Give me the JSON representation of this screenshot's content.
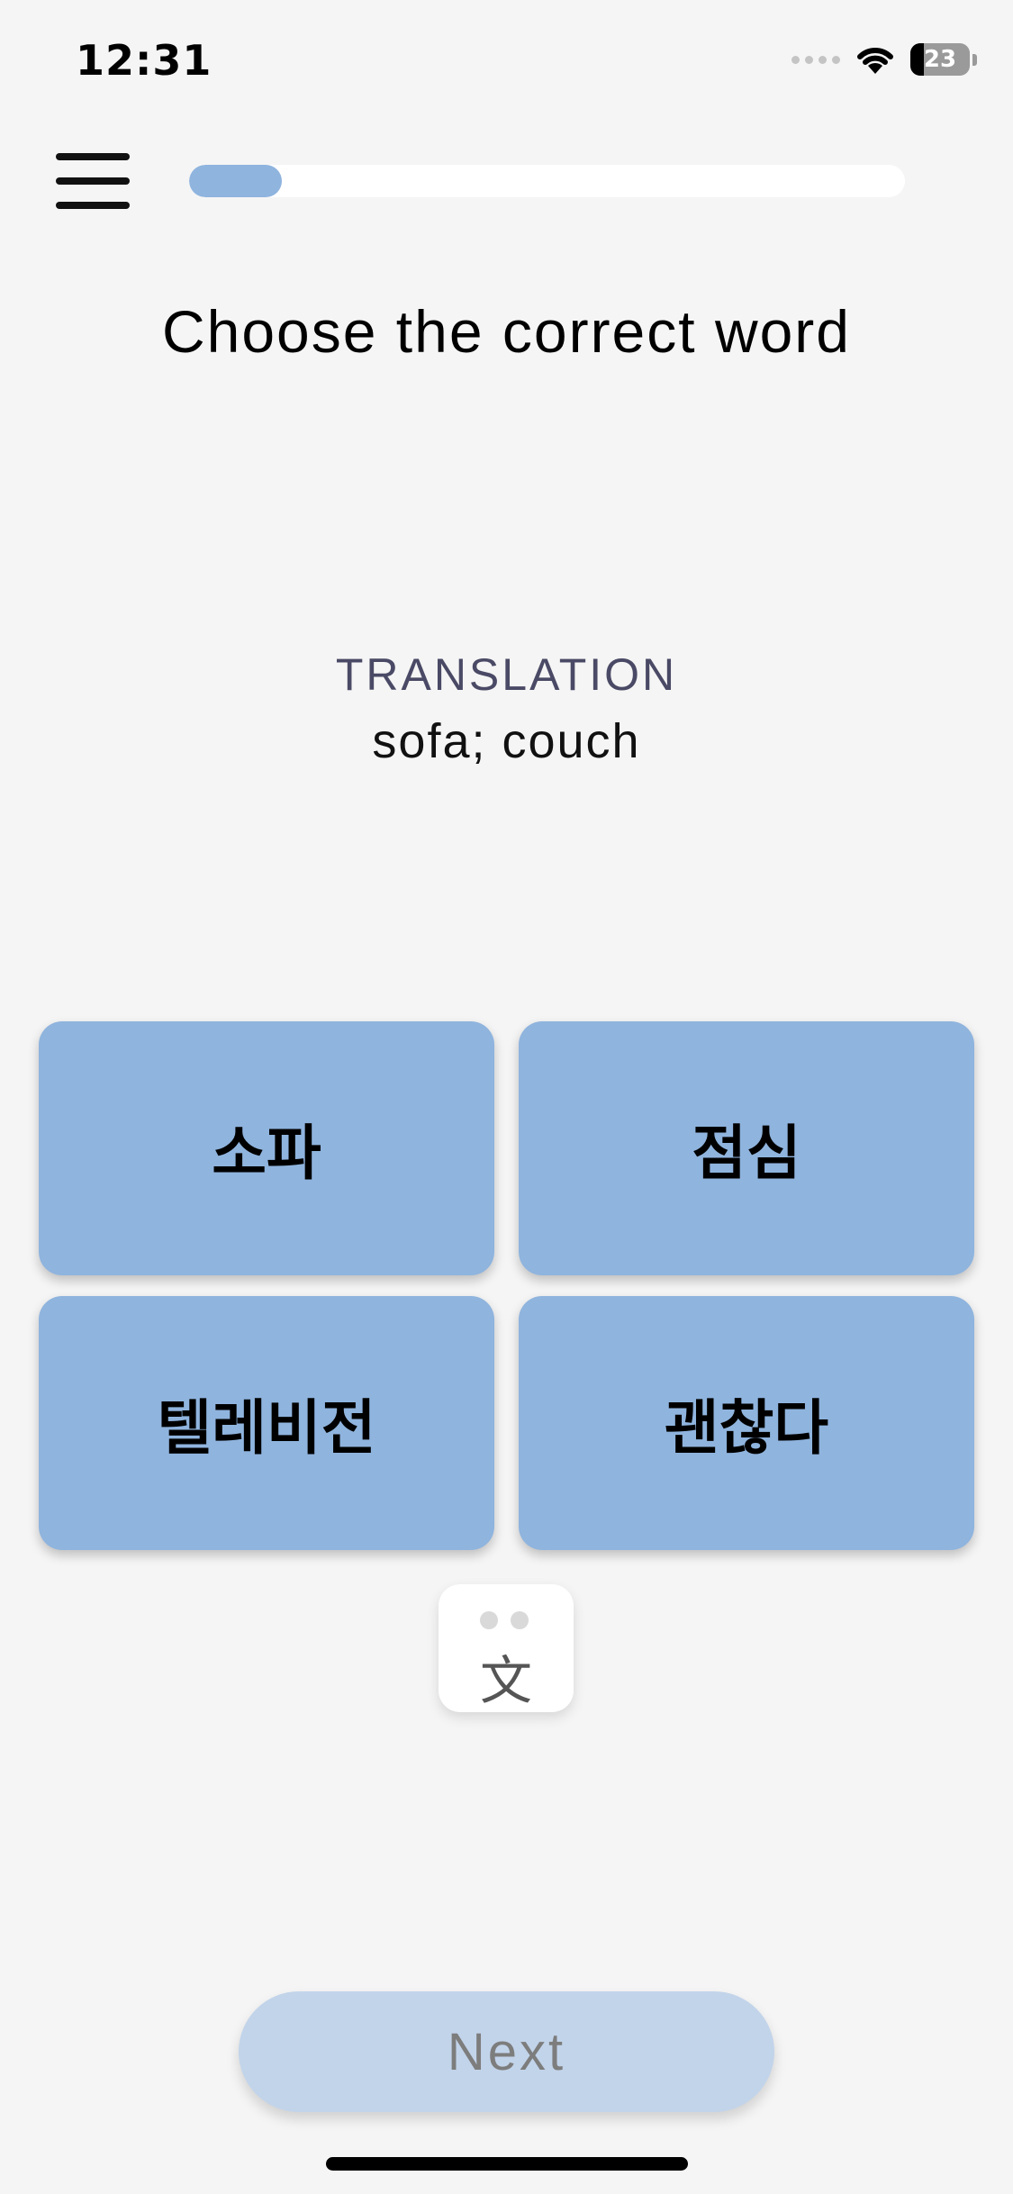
{
  "status_bar": {
    "time": "12:31",
    "battery_level": "23",
    "battery_fraction": 0.23,
    "wifi_icon": "wifi-icon",
    "signal_icon": "cellular-signal-icon"
  },
  "header": {
    "menu_icon": "hamburger-menu-icon",
    "progress_fraction": 0.13
  },
  "prompt": {
    "instruction": "Choose the correct word",
    "translation_label": "TRANSLATION",
    "translation_value": "sofa; couch"
  },
  "options": [
    {
      "label": "소파"
    },
    {
      "label": "점심"
    },
    {
      "label": "텔레비전"
    },
    {
      "label": "괜찮다"
    }
  ],
  "translate_toggle": {
    "glyph": "文",
    "icon": "translate-icon"
  },
  "footer": {
    "next_label": "Next"
  },
  "colors": {
    "background": "#f5f5f5",
    "accent": "#8fb4de",
    "next_disabled": "#c2d4ea"
  }
}
